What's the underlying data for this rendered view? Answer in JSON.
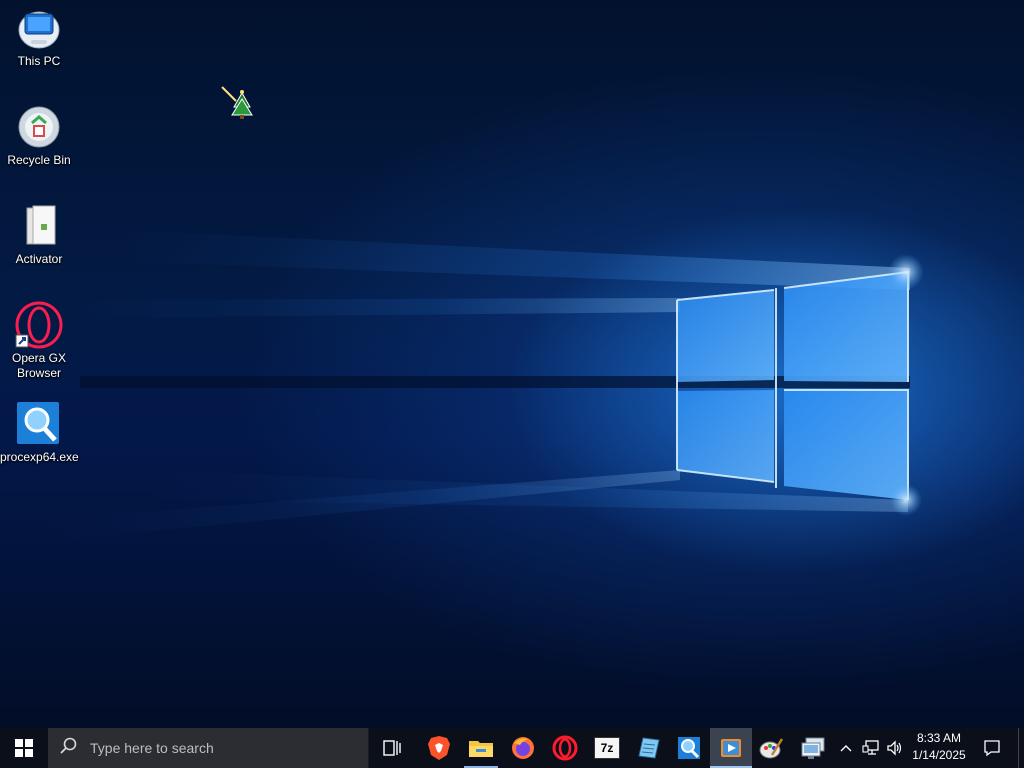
{
  "desktop": {
    "icons": [
      {
        "label": "This PC",
        "icon": "monitor-icon"
      },
      {
        "label": "Recycle Bin",
        "icon": "recycle-bin-icon"
      },
      {
        "label": "Activator",
        "icon": "document-icon"
      },
      {
        "label": "Opera GX Browser",
        "icon": "opera-gx-icon"
      },
      {
        "label": "procexp64.exe",
        "icon": "process-explorer-icon"
      }
    ]
  },
  "taskbar": {
    "search_placeholder": "Type here to search",
    "apps": [
      {
        "name": "Task View",
        "icon": "task-view-icon"
      },
      {
        "name": "Brave",
        "icon": "brave-icon"
      },
      {
        "name": "File Explorer",
        "icon": "folder-icon"
      },
      {
        "name": "Firefox",
        "icon": "firefox-icon"
      },
      {
        "name": "Opera",
        "icon": "opera-icon"
      },
      {
        "name": "7-Zip",
        "icon": "7zip-icon",
        "text": "7z"
      },
      {
        "name": "Notepad",
        "icon": "notepad-icon"
      },
      {
        "name": "Process Explorer",
        "icon": "process-explorer-icon"
      },
      {
        "name": "Media Player",
        "icon": "media-player-icon"
      },
      {
        "name": "Paint",
        "icon": "paint-icon"
      },
      {
        "name": "Remote Desktop",
        "icon": "remote-desktop-icon"
      }
    ],
    "clock": {
      "time": "8:33 AM",
      "date": "1/14/2025"
    }
  },
  "colors": {
    "taskbar_bg": "#0b0f1a",
    "search_bg": "#2b2d33",
    "accent": "#1e90ff"
  }
}
